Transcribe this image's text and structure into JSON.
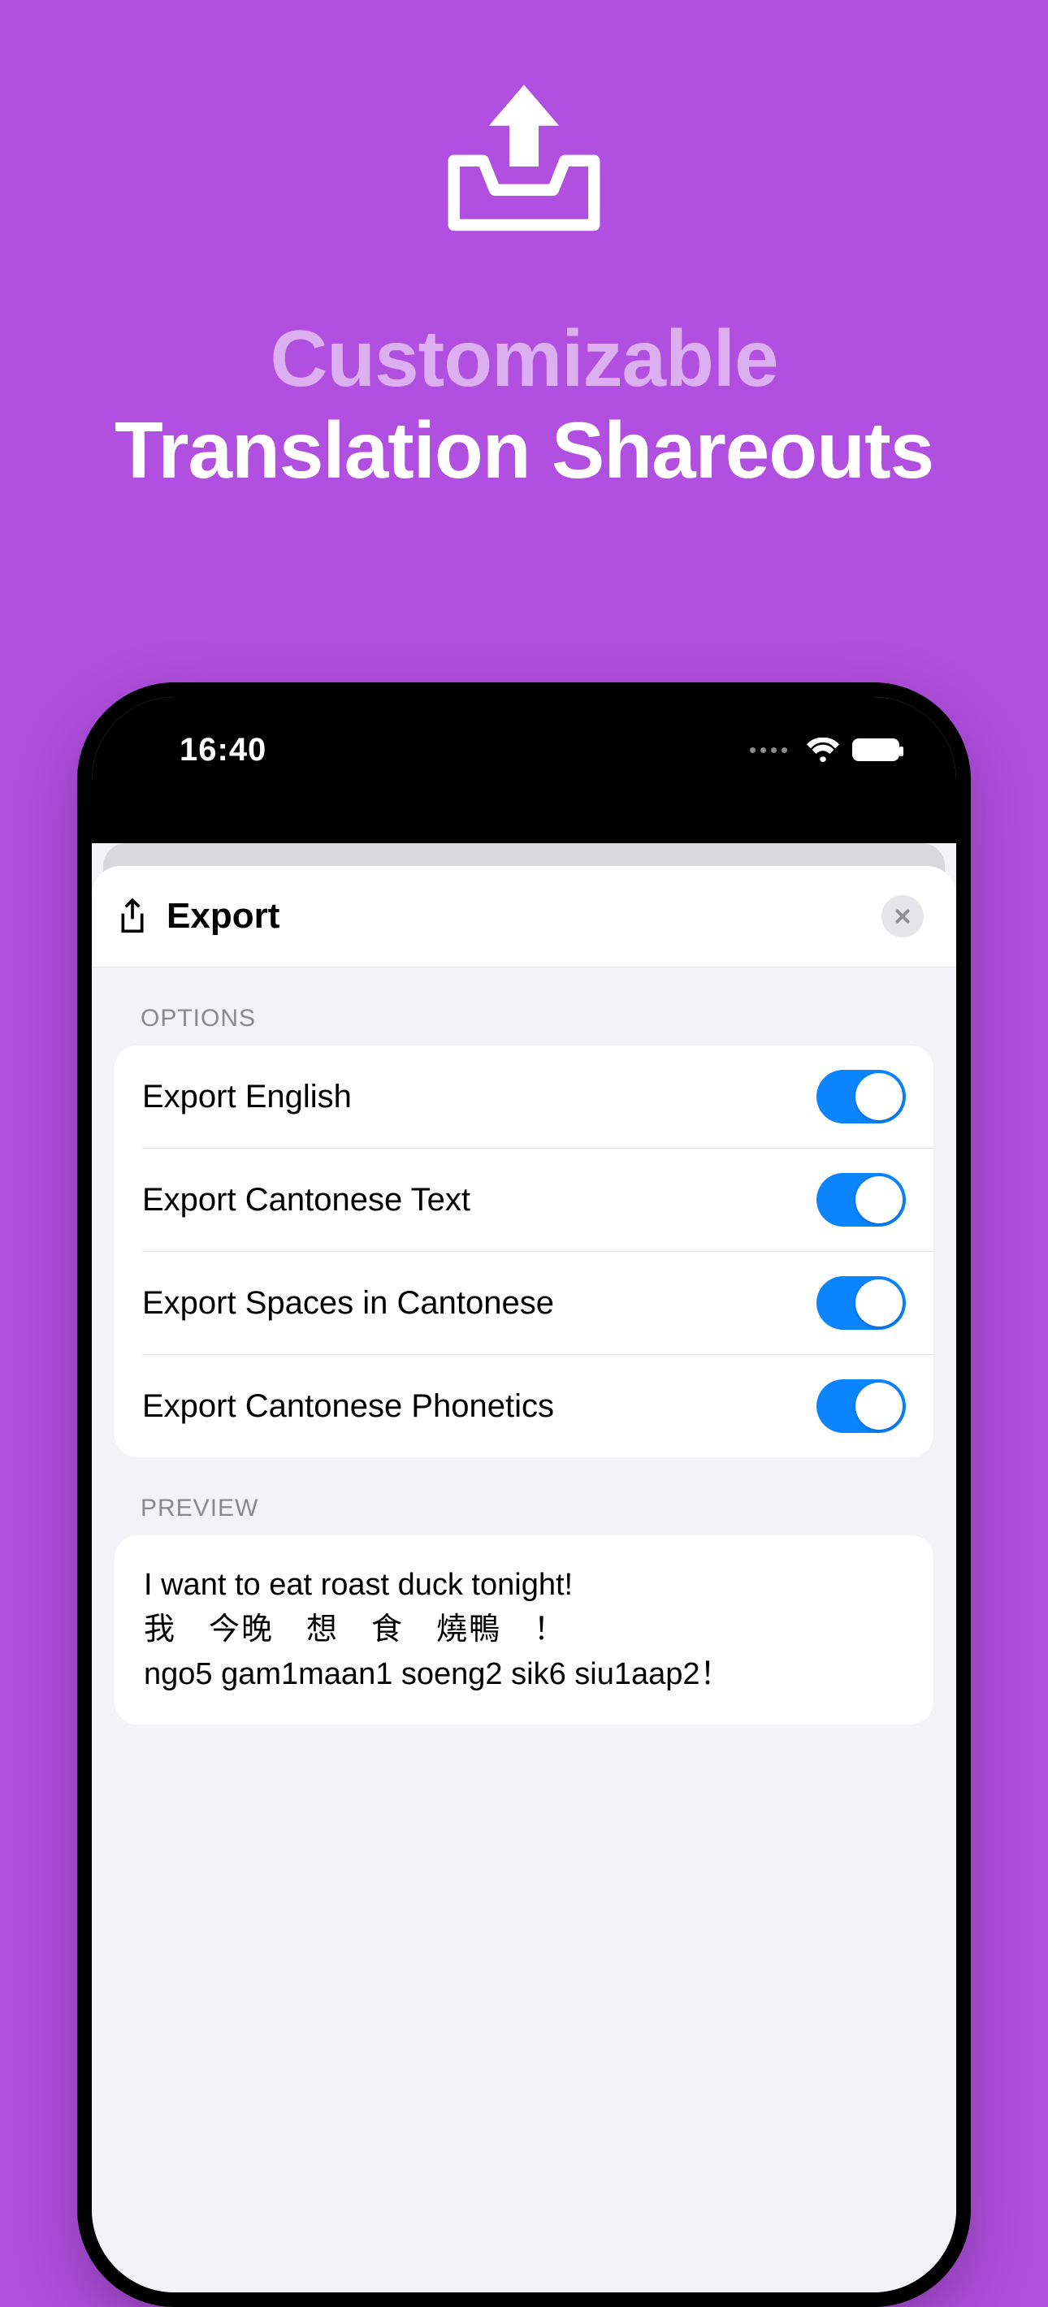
{
  "hero": {
    "line1": "Customizable",
    "line2": "Translation Shareouts"
  },
  "status": {
    "time": "16:40"
  },
  "sheet": {
    "title": "Export",
    "sections": {
      "options_label": "OPTIONS",
      "preview_label": "PREVIEW"
    },
    "options": [
      {
        "label": "Export English",
        "on": true
      },
      {
        "label": "Export Cantonese Text",
        "on": true
      },
      {
        "label": "Export Spaces in Cantonese",
        "on": true
      },
      {
        "label": "Export Cantonese Phonetics",
        "on": true
      }
    ],
    "preview": {
      "english": "I want to eat roast duck tonight!",
      "cantonese": "我　今晚　想　食　燒鴨　！",
      "phonetics": "ngo5 gam1maan1 soeng2 sik6 siu1aap2！"
    }
  }
}
